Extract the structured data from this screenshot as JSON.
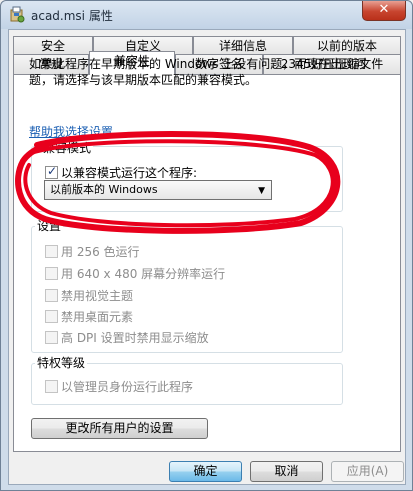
{
  "window": {
    "title": "acad.msi 属性",
    "close_glyph": "✕"
  },
  "tabs_row1": [
    "安全",
    "自定义",
    "详细信息",
    "以前的版本"
  ],
  "tabs_row2": [
    "常规",
    "兼容性",
    "数字签名",
    "2345好压压缩文件"
  ],
  "active_tab": "兼容性",
  "intro_text": "如果此程序在早期版本的 Windows 上没有问题，而现在出现问题，请选择与该早期版本匹配的兼容模式。",
  "help_link": "帮助我选择设置",
  "compat_group": {
    "label": "兼容模式",
    "checkbox_label": "以兼容模式运行这个程序:",
    "checked": true,
    "select_value": "以前版本的 Windows"
  },
  "settings_group": {
    "label": "设置",
    "items": [
      "用 256 色运行",
      "用 640 x 480 屏幕分辨率运行",
      "禁用视觉主题",
      "禁用桌面元素",
      "高 DPI 设置时禁用显示缩放"
    ]
  },
  "privilege_group": {
    "label": "特权等级",
    "item": "以管理员身份运行此程序"
  },
  "change_all_button": "更改所有用户的设置",
  "buttons": {
    "ok": "确定",
    "cancel": "取消",
    "apply": "应用(A)"
  },
  "annotation_color": "#e8001c"
}
